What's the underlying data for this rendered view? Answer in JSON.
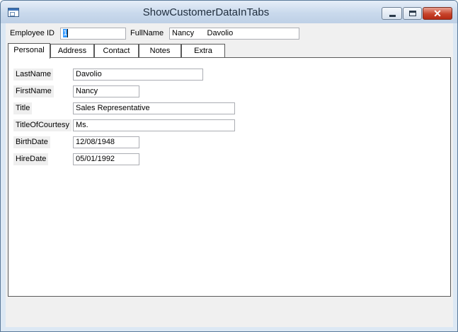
{
  "window": {
    "title": "ShowCustomerDataInTabs"
  },
  "header": {
    "employee_id_label": "Employee ID",
    "employee_id_value": "1",
    "fullname_label": "FullName",
    "fullname_value": "Nancy      Davolio"
  },
  "tabs": [
    {
      "label": "Personal",
      "selected": true
    },
    {
      "label": "Address",
      "selected": false
    },
    {
      "label": "Contact",
      "selected": false
    },
    {
      "label": "Notes",
      "selected": false
    },
    {
      "label": "Extra",
      "selected": false
    }
  ],
  "personal": {
    "fields": [
      {
        "label": "LastName",
        "value": "Davolio"
      },
      {
        "label": "FirstName",
        "value": "Nancy"
      },
      {
        "label": "Title",
        "value": "Sales Representative"
      },
      {
        "label": "TitleOfCourtesy",
        "value": "Ms."
      },
      {
        "label": "BirthDate",
        "value": "12/08/1948"
      },
      {
        "label": "HireDate",
        "value": "05/01/1992"
      }
    ]
  },
  "icons": {
    "app": "application-icon",
    "minimize": "minimize-icon",
    "maximize": "maximize-icon",
    "close": "close-icon"
  },
  "colors": {
    "selection": "#3399ff",
    "close_button": "#c7432a",
    "window_border": "#5b7a9a"
  }
}
